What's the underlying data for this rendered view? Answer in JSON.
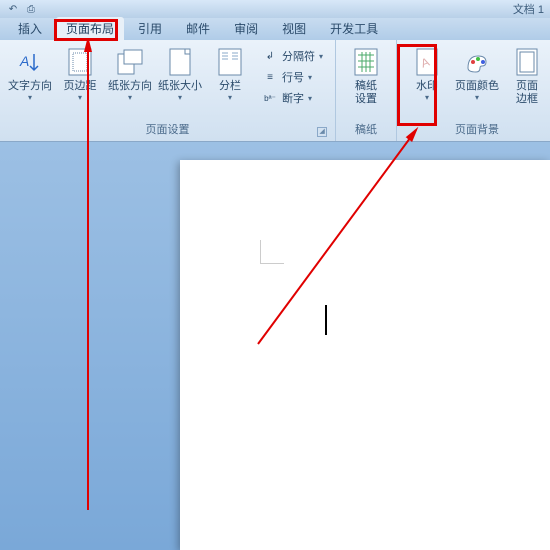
{
  "titlebar": {
    "doc_title": "文档 1"
  },
  "tabs": {
    "items": [
      {
        "label": "插入"
      },
      {
        "label": "页面布局"
      },
      {
        "label": "引用"
      },
      {
        "label": "邮件"
      },
      {
        "label": "审阅"
      },
      {
        "label": "视图"
      },
      {
        "label": "开发工具"
      }
    ],
    "active_index": 1
  },
  "ribbon": {
    "groups": [
      {
        "name": "页面设置",
        "buttons": [
          {
            "label": "文字方向",
            "icon": "text-direction"
          },
          {
            "label": "页边距",
            "icon": "margins"
          },
          {
            "label": "纸张方向",
            "icon": "orientation"
          },
          {
            "label": "纸张大小",
            "icon": "size"
          },
          {
            "label": "分栏",
            "icon": "columns"
          }
        ],
        "small_buttons": [
          {
            "label": "分隔符",
            "icon": "breaks"
          },
          {
            "label": "行号",
            "icon": "line-numbers"
          },
          {
            "label": "断字",
            "icon": "hyphenation"
          }
        ]
      },
      {
        "name": "稿纸",
        "buttons": [
          {
            "label": "稿纸\n设置",
            "icon": "manuscript"
          }
        ]
      },
      {
        "name": "页面背景",
        "buttons": [
          {
            "label": "水印",
            "icon": "watermark"
          },
          {
            "label": "页面颜色",
            "icon": "page-color"
          },
          {
            "label": "页面\n边框",
            "icon": "page-border"
          }
        ]
      }
    ]
  }
}
